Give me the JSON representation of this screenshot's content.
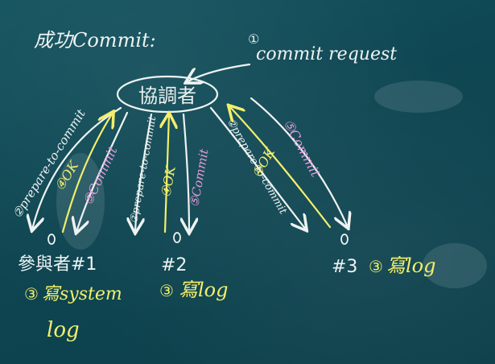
{
  "title": "成功Commit:",
  "request": {
    "number": "①",
    "text": "commit request"
  },
  "coordinator": "協調者",
  "participants": [
    {
      "label": "參與者#1",
      "log_number": "③",
      "log_text": "寫system",
      "log_text2": "log"
    },
    {
      "label": "#2",
      "log_number": "③",
      "log_text": "寫log"
    },
    {
      "label": "#3",
      "log_number": "③",
      "log_text": "寫log"
    }
  ],
  "messages": {
    "prepare": "②prepare-to-commit",
    "ok": "④OK",
    "commit": "⑤Commit"
  },
  "colors": {
    "board": "#0f4a56",
    "white_chalk": "#eef3f2",
    "yellow_chalk": "#f3ef6a",
    "pink_chalk": "#e59ad7"
  }
}
